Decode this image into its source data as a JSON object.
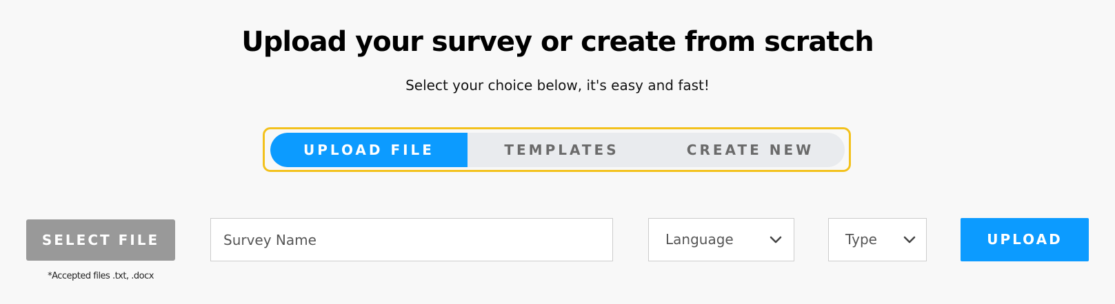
{
  "header": {
    "title": "Upload your survey or create from scratch",
    "subtitle": "Select your choice below, it's easy and fast!"
  },
  "tabs": [
    {
      "label": "UPLOAD FILE",
      "active": true
    },
    {
      "label": "TEMPLATES",
      "active": false
    },
    {
      "label": "CREATE NEW",
      "active": false
    }
  ],
  "form": {
    "select_file_label": "SELECT FILE",
    "accepted_note": "*Accepted files .txt, .docx",
    "survey_name": {
      "value": "",
      "placeholder": "Survey Name"
    },
    "language": {
      "selected": "Language",
      "icon": "chevron-down-icon"
    },
    "type": {
      "selected": "Type",
      "icon": "chevron-down-icon"
    },
    "upload_label": "UPLOAD"
  },
  "colors": {
    "accent": "#0c9bff",
    "highlight_border": "#f3c11c",
    "select_file_bg": "#999999",
    "tab_bg": "#e9ebee"
  }
}
